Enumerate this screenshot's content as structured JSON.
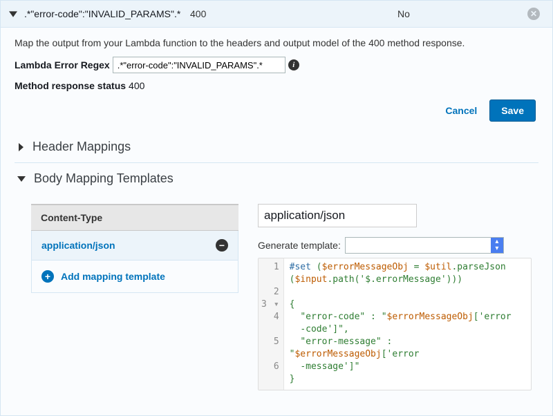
{
  "row": {
    "pattern": "\".*\\\"error-code\\\":\\\"INVALID_PARAMS\\\".*\"",
    "pattern_display": ".*\"error-code\":\"INVALID_PARAMS\".*",
    "status": "400",
    "proxy": "No"
  },
  "description": "Map the output from your Lambda function to the headers and output model of the 400 method response.",
  "fields": {
    "regex_label": "Lambda Error Regex",
    "regex_value": ".*\"error-code\":\"INVALID_PARAMS\".*",
    "method_status_label": "Method response status",
    "method_status_value": "400"
  },
  "buttons": {
    "cancel": "Cancel",
    "save": "Save"
  },
  "sections": {
    "header_mappings": "Header Mappings",
    "body_templates": "Body Mapping Templates"
  },
  "content_type": {
    "header": "Content-Type",
    "items": [
      "application/json"
    ],
    "add_label": "Add mapping template",
    "editor_value": "application/json",
    "generate_label": "Generate template:"
  },
  "code_lines": [
    "#set ($errorMessageObj = $util.parseJson($input.path('$.errorMessage')))",
    "",
    "{",
    "  \"error-code\" : \"$errorMessageObj['error-code']\",",
    "  \"error-message\" : \"$errorMessageObj['error-message']\"",
    "}"
  ],
  "chart_data": null
}
